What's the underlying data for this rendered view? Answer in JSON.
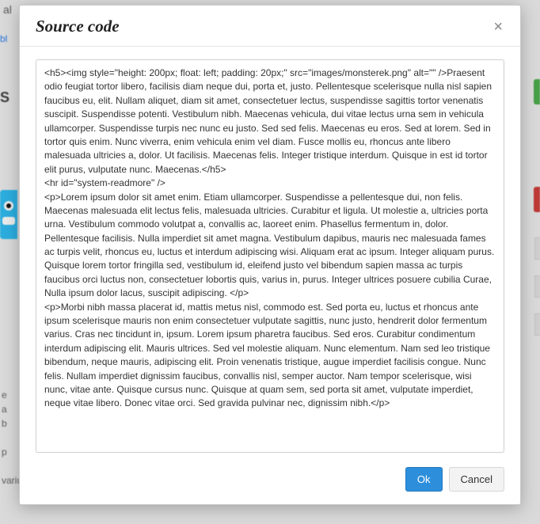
{
  "modal": {
    "title": "Source code",
    "close_glyph": "×",
    "ok_label": "Ok",
    "cancel_label": "Cancel",
    "source_value": "<h5><img style=\"height: 200px; float: left; padding: 20px;\" src=\"images/monsterek.png\" alt=\"\" />Praesent odio feugiat tortor libero, facilisis diam neque dui, porta et, justo. Pellentesque scelerisque nulla nisl sapien faucibus eu, elit. Nullam aliquet, diam sit amet, consectetuer lectus, suspendisse sagittis tortor venenatis suscipit. Suspendisse potenti. Vestibulum nibh. Maecenas vehicula, dui vitae lectus urna sem in vehicula ullamcorper. Suspendisse turpis nec nunc eu justo. Sed sed felis. Maecenas eu eros. Sed at lorem. Sed in tortor quis enim. Nunc viverra, enim vehicula enim vel diam. Fusce mollis eu, rhoncus ante libero malesuada ultricies a, dolor. Ut facilisis. Maecenas felis. Integer tristique interdum. Quisque in est id tortor elit purus, vulputate nunc. Maecenas.</h5>\n<hr id=\"system-readmore\" />\n<p>Lorem ipsum dolor sit amet enim. Etiam ullamcorper. Suspendisse a pellentesque dui, non felis. Maecenas malesuada elit lectus felis, malesuada ultricies. Curabitur et ligula. Ut molestie a, ultricies porta urna. Vestibulum commodo volutpat a, convallis ac, laoreet enim. Phasellus fermentum in, dolor. Pellentesque facilisis. Nulla imperdiet sit amet magna. Vestibulum dapibus, mauris nec malesuada fames ac turpis velit, rhoncus eu, luctus et interdum adipiscing wisi. Aliquam erat ac ipsum. Integer aliquam purus. Quisque lorem tortor fringilla sed, vestibulum id, eleifend justo vel bibendum sapien massa ac turpis faucibus orci luctus non, consectetuer lobortis quis, varius in, purus. Integer ultrices posuere cubilia Curae, Nulla ipsum dolor lacus, suscipit adipiscing. </p>\n<p>Morbi nibh massa placerat id, mattis metus nisl, commodo est. Sed porta eu, luctus et rhoncus ante ipsum scelerisque mauris non enim consectetuer vulputate sagittis, nunc justo, hendrerit dolor fermentum varius. Cras nec tincidunt in, ipsum. Lorem ipsum pharetra faucibus. Sed eros. Curabitur condimentum interdum adipiscing elit. Mauris ultrices. Sed vel molestie aliquam. Nunc elementum. Nam sed leo tristique bibendum, neque mauris, adipiscing elit. Proin venenatis tristique, augue imperdiet facilisis congue. Nunc felis. Nullam imperdiet dignissim faucibus, convallis nisl, semper auctor. Nam tempor scelerisque, wisi nunc, vitae ante. Quisque cursus nunc. Quisque at quam sem, sed porta sit amet, vulputate imperdiet, neque vitae libero. Donec vitae orci. Sed gravida pulvinar nec, dignissim nibh.</p>"
  },
  "background": {
    "fragment_a": "al",
    "fragment_b": "bl",
    "fragment_s": "S",
    "paragraph_a": "e",
    "paragraph_b": "a",
    "paragraph_c": "b",
    "paragraph_d": "p",
    "tail": "varius. Cras nec tincidunt in, ipsum. Lorem ipsum pharetra faucibus. Sed eros."
  }
}
